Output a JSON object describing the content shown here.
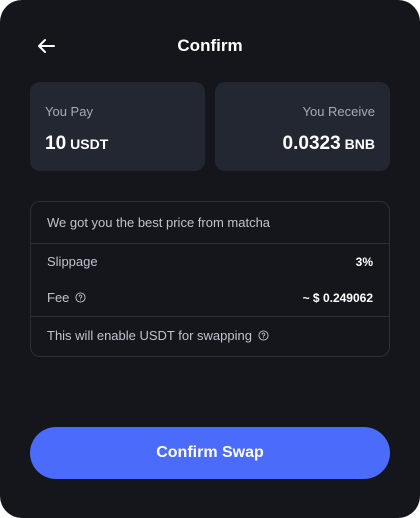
{
  "header": {
    "title": "Confirm",
    "back_icon": "arrow-left-icon"
  },
  "pay": {
    "label": "You Pay",
    "amount": "10",
    "token": "USDT"
  },
  "receive": {
    "label": "You Receive",
    "amount": "0.0323",
    "token": "BNB"
  },
  "details": {
    "best_price": "We got you the best price from matcha",
    "slippage_label": "Slippage",
    "slippage_value": "3%",
    "fee_label": "Fee",
    "fee_value": "~ $ 0.249062",
    "enable_note": "This will enable USDT for swapping",
    "help_icon": "question-circle-icon"
  },
  "confirm_button": {
    "label": "Confirm Swap"
  },
  "colors": {
    "background": "#14161c",
    "card": "#232732",
    "border": "#2b2f3a",
    "accent": "#4b6bfb",
    "muted_text": "#bfc3cc"
  }
}
